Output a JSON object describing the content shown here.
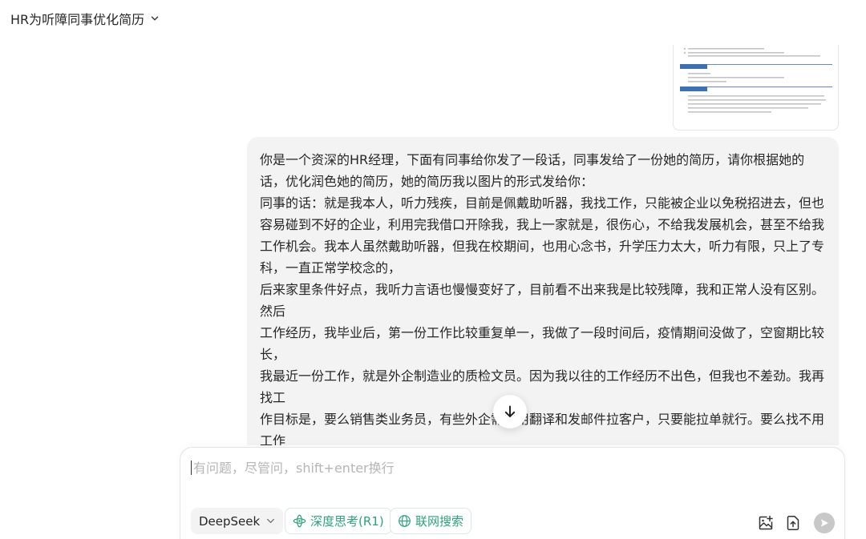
{
  "header": {
    "title": "HR为听障同事优化简历",
    "chevron_icon": "chevron-down-icon"
  },
  "attachment": {
    "kind": "resume-image-thumbnail",
    "accent_color": "#3b6fb6"
  },
  "message": {
    "role": "user",
    "lines": [
      "你是一个资深的HR经理，下面有同事给你发了一段话，同事发给了一份她的简历，请你根据她的话，优化润色她的简历，她的简历我以图片的形式发给你：",
      "同事的话：就是我本人，听力残疾，目前是佩戴助听器，我找工作，只能被企业以免税招进去，但也容易碰到不好的企业，利用完我借口开除我，我上一家就是，很伤心，不给我发展机会，甚至不给我工作机会。我本人虽然戴助听器，但我在校期间，也用心念书，升学压力太大，听力有限，只上了专科，一直正常学校念的，",
      "后来家里条件好点，我听力言语也慢慢变好了，目前看不出来我是比较残障，我和正常人没有区别。然后",
      "工作经历，我毕业后，第一份工作比较重复单一，我做了一段时间后，疫情期间没做了，空窗期比较长，",
      "我最近一份工作，就是外企制造业的质检文员。因为我以往的工作经历不出色，但我也不差劲。我再找工",
      "作目标是，要么销售类业务员，有些外企需要用翻译和发邮件拉客户，只要能拉单就行。要么找不用工作"
    ]
  },
  "scroll_button": {
    "icon": "arrow-down-icon"
  },
  "composer": {
    "placeholder": "有问题，尽管问，shift+enter换行",
    "value": "",
    "model_label": "DeepSeek",
    "deep_think_label": "深度思考(R1)",
    "web_search_label": "联网搜索",
    "accent_color": "#2aa378",
    "icons": {
      "model": "chevron-down-icon",
      "deep_think": "atom-icon",
      "web_search": "globe-icon",
      "image": "image-add-icon",
      "upload": "upload-icon",
      "send": "send-icon"
    }
  }
}
